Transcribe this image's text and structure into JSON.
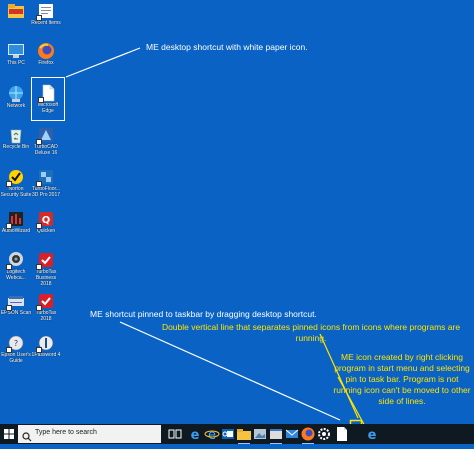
{
  "desktop": {
    "icons": [
      {
        "label": "",
        "glyph": "folder-icon"
      },
      {
        "label": "Recent Items",
        "glyph": "recent-items-icon"
      },
      {
        "label": "This PC",
        "glyph": "computer-icon"
      },
      {
        "label": "Firefox",
        "glyph": "firefox-icon"
      },
      {
        "label": "Network",
        "glyph": "network-icon"
      },
      {
        "label": "Microsoft Edge",
        "glyph": "edge-paper-icon"
      },
      {
        "label": "Recycle Bin",
        "glyph": "recycle-bin-icon"
      },
      {
        "label": "TurboCAD Deluxe 16",
        "glyph": "turbocad-icon"
      },
      {
        "label": "Norton Security Suite",
        "glyph": "norton-icon"
      },
      {
        "label": "TurboFloor... 3D Pro 2017",
        "glyph": "turbofloor-icon"
      },
      {
        "label": "AudioWizard",
        "glyph": "audiowizard-icon"
      },
      {
        "label": "Quicken",
        "glyph": "quicken-icon"
      },
      {
        "label": "Logitech Webca...",
        "glyph": "webcam-icon"
      },
      {
        "label": "TurboTax Business 2018",
        "glyph": "turbotax-icon"
      },
      {
        "label": "EPSON Scan",
        "glyph": "epson-scan-icon"
      },
      {
        "label": "TurboTax 2018",
        "glyph": "turbotax-icon"
      },
      {
        "label": "Epson User's Guide",
        "glyph": "epson-guide-icon"
      },
      {
        "label": "1Password 4",
        "glyph": "1password-icon"
      }
    ]
  },
  "annotations": {
    "desktop_shortcut": "ME desktop shortcut with white paper icon.",
    "pinned_shortcut": "ME shortcut pinned to taskbar by dragging desktop shortcut.",
    "double_line": "Double vertical line that separates pinned icons from icons where programs are running.",
    "me_icon": "ME icon created by right clicking program in start menu and selecting pin to task bar. Program is not running icon can't be moved to other side of lines."
  },
  "taskbar": {
    "search_placeholder": "Type here to search",
    "items": [
      "task-view-icon",
      "edge-icon",
      "internet-explorer-icon",
      "outlook-icon",
      "folder-icon",
      "photos-icon",
      "window-icon",
      "mail-icon",
      "firefox-icon",
      "settings-icon",
      "edge-paper-icon",
      "edge-icon"
    ]
  },
  "colors": {
    "desktop_bg": "#0a63c4",
    "annotation_white": "#ffffff",
    "annotation_yellow": "#ffe400",
    "taskbar_bg": "#0f1922"
  }
}
